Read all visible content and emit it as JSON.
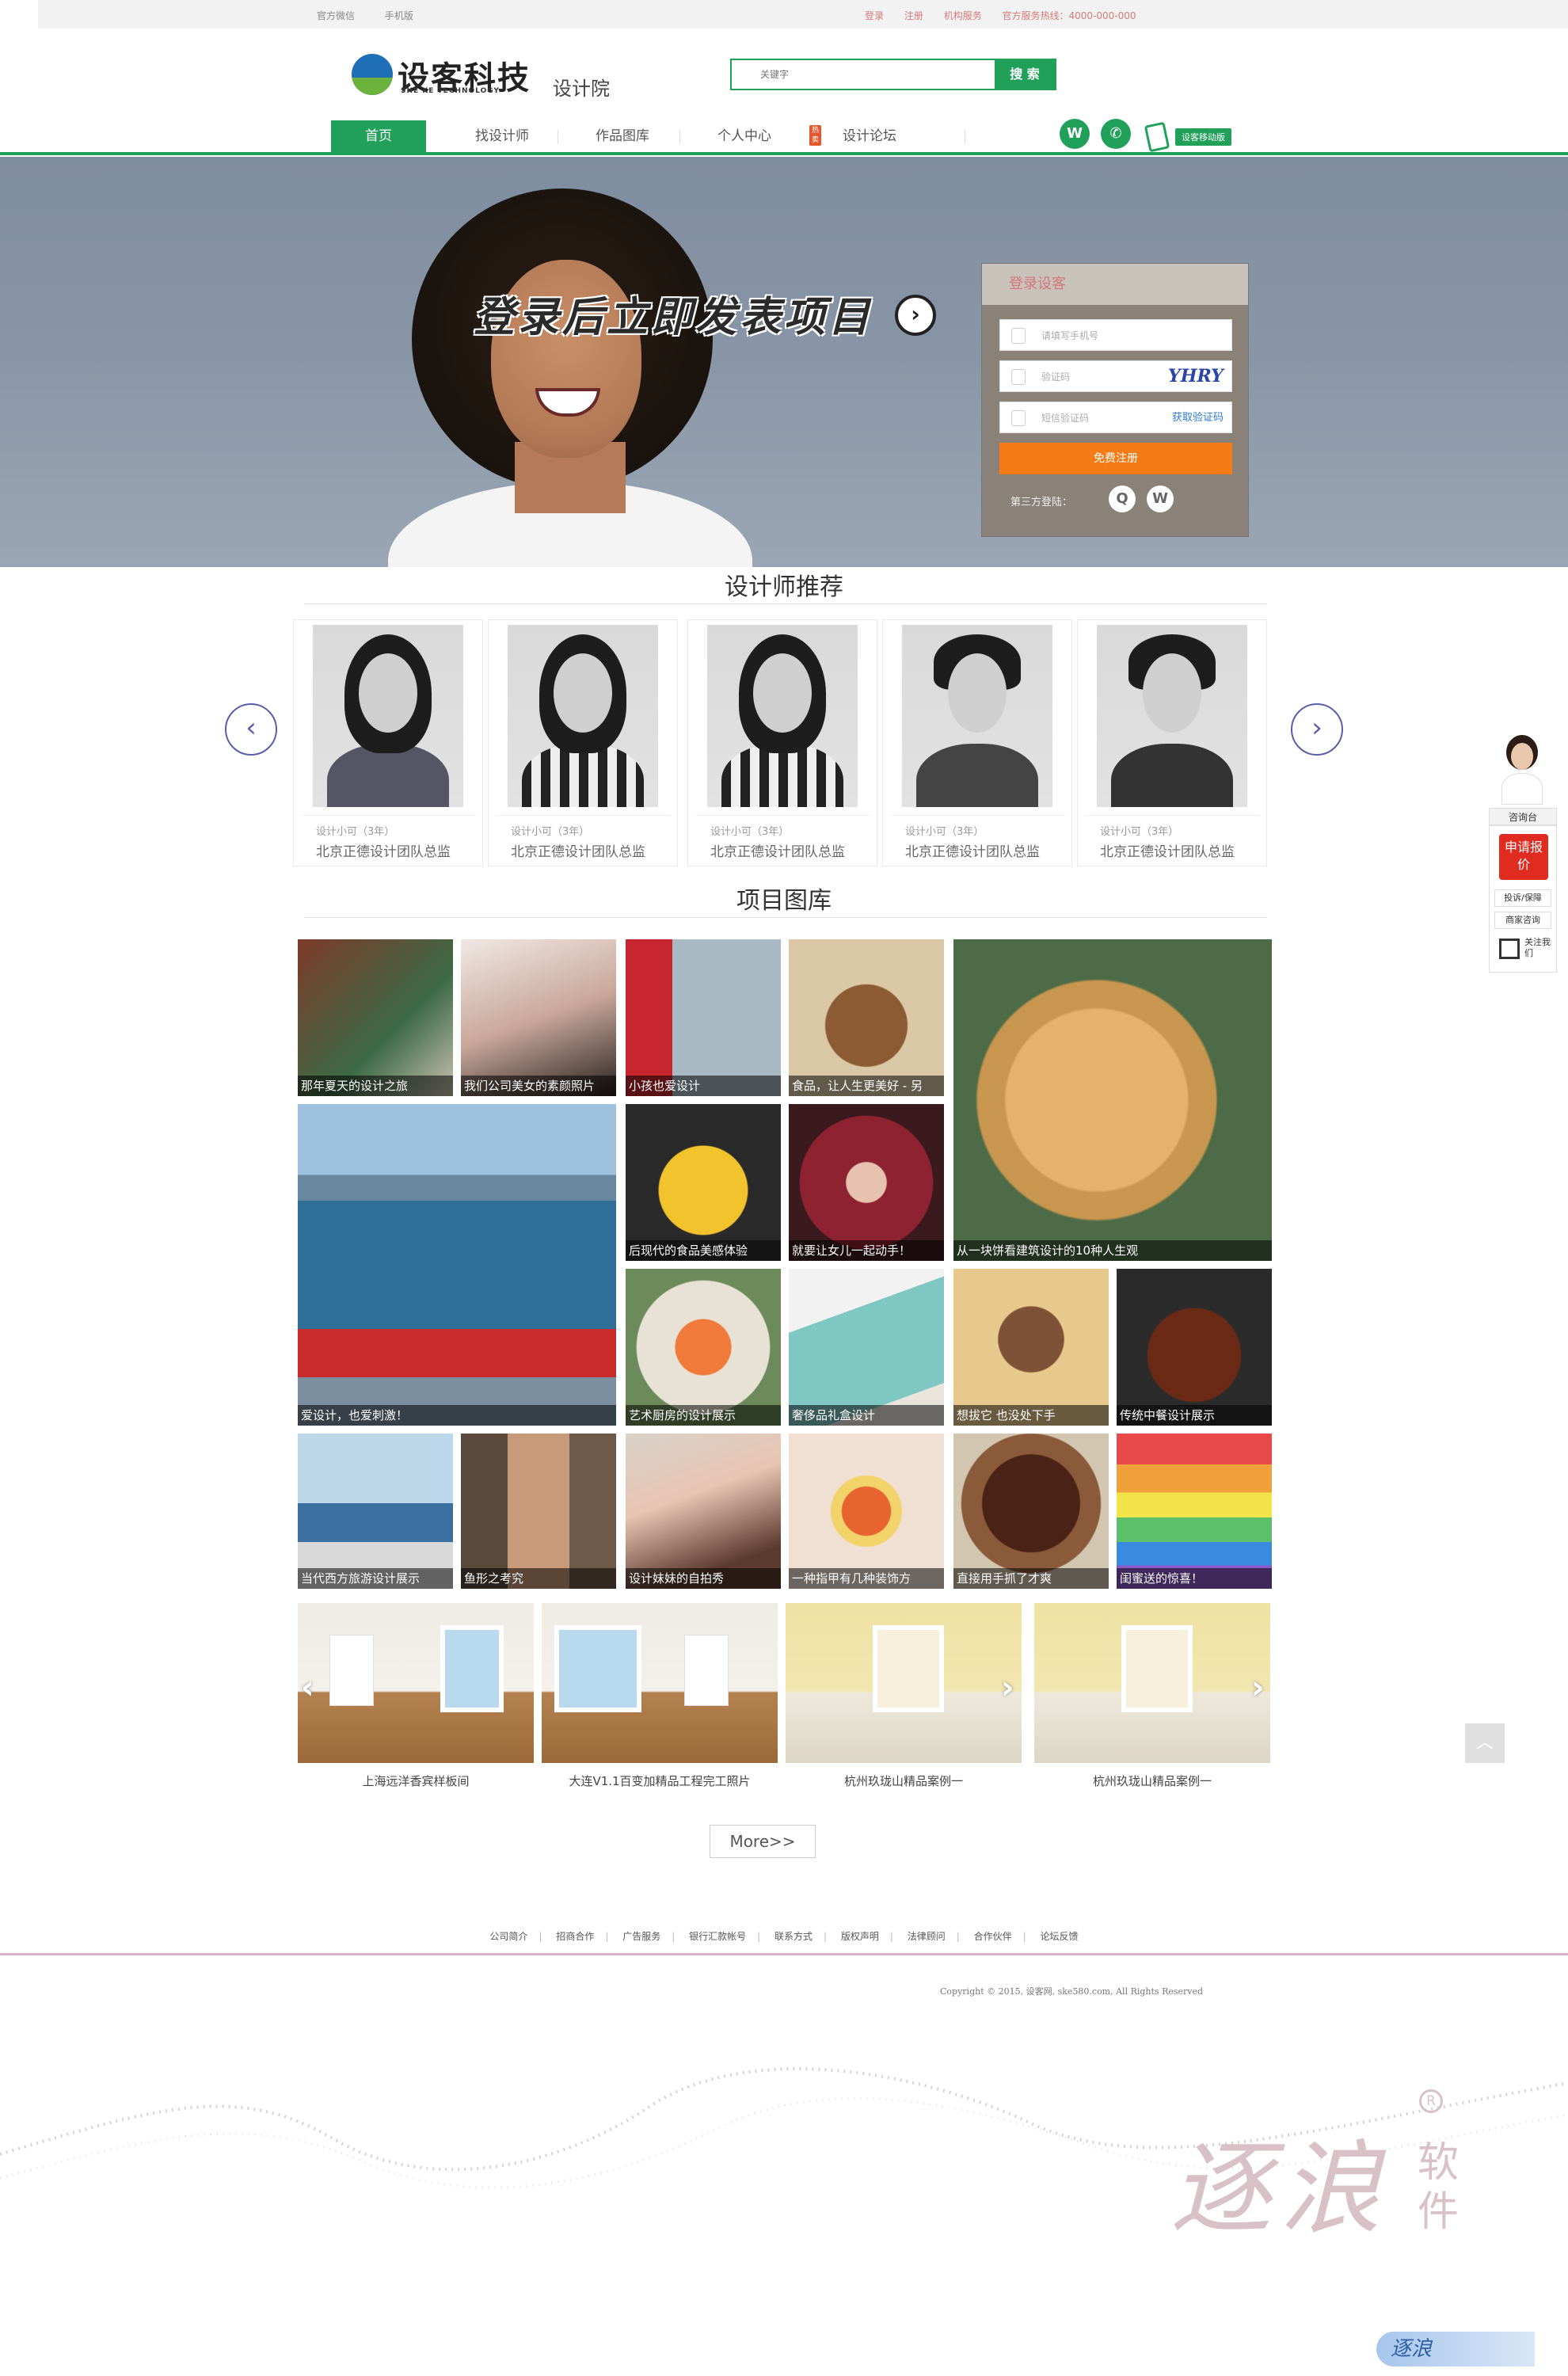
{
  "topbar": {
    "left": [
      "官方微信",
      "手机版"
    ],
    "right": [
      "登录",
      "注册",
      "机构服务",
      "官方服务热线：4000-000-000"
    ]
  },
  "header": {
    "logo_name": "设客科技",
    "logo_en": "SHE KE TECHNOLOGY",
    "subtitle": "设计院",
    "search_placeholder": "关键字",
    "search_button": "搜 索"
  },
  "nav": {
    "items": [
      "首页",
      "找设计师",
      "作品图库",
      "个人中心",
      "设计论坛"
    ],
    "hot_badge": "热卖",
    "mobile_badge": "设客移动版",
    "accent": "#21a05a"
  },
  "banner": {
    "slogan": "登录后立即发表项目",
    "login": {
      "title": "登录设客",
      "phone_placeholder": "请填写手机号",
      "captcha_placeholder": "验证码",
      "captcha_text": "YHRY",
      "sms_placeholder": "短信验证码",
      "get_code": "获取验证码",
      "submit": "免费注册",
      "third_party": "第三方登陆："
    }
  },
  "designers": {
    "title": "设计师推荐",
    "cards": [
      {
        "role": "设计小可（3年）",
        "desc": "北京正德设计团队总监"
      },
      {
        "role": "设计小可（3年）",
        "desc": "北京正德设计团队总监"
      },
      {
        "role": "设计小可（3年）",
        "desc": "北京正德设计团队总监"
      },
      {
        "role": "设计小可（3年）",
        "desc": "北京正德设计团队总监"
      },
      {
        "role": "设计小可（3年）",
        "desc": "北京正德设计团队总监"
      }
    ]
  },
  "gallery": {
    "title": "项目图库",
    "tiles": [
      "那年夏天的设计之旅",
      "我们公司美女的素颜照片",
      "小孩也爱设计",
      "食品，让人生更美好 - 另",
      "从一块饼看建筑设计的10种人生观",
      "爱设计，也爱刺激！",
      "后现代的食品美感体验",
      "就要让女儿一起动手！",
      "艺术厨房的设计展示",
      "奢侈品礼盒设计",
      "想拔它 也没处下手",
      "传统中餐设计展示",
      "当代西方旅游设计展示",
      "鱼形之考究",
      "设计妹妹的自拍秀",
      "一种指甲有几种装饰方",
      "直接用手抓了才爽",
      "闺蜜送的惊喜！"
    ]
  },
  "cases": {
    "items": [
      "上海远洋香宾样板间",
      "大连V1.1百变加精品工程完工照片",
      "杭州玖珑山精品案例一",
      "杭州玖珑山精品案例一"
    ],
    "more": "More>>"
  },
  "footer": {
    "links": [
      "公司简介",
      "招商合作",
      "广告服务",
      "银行汇款帐号",
      "联系方式",
      "版权声明",
      "法律顾问",
      "合作伙伴",
      "论坛反馈"
    ],
    "copyright": "Copyright © 2015, 设客网, ske580.com, All Rights Reserved",
    "brand": "逐浪",
    "brand_side": "软件",
    "brand_badge": "逐浪"
  },
  "side": {
    "label": "咨询台",
    "quote": "申请报价",
    "items": [
      "投诉/保障",
      "商家咨询"
    ],
    "follow": "关注我们"
  }
}
